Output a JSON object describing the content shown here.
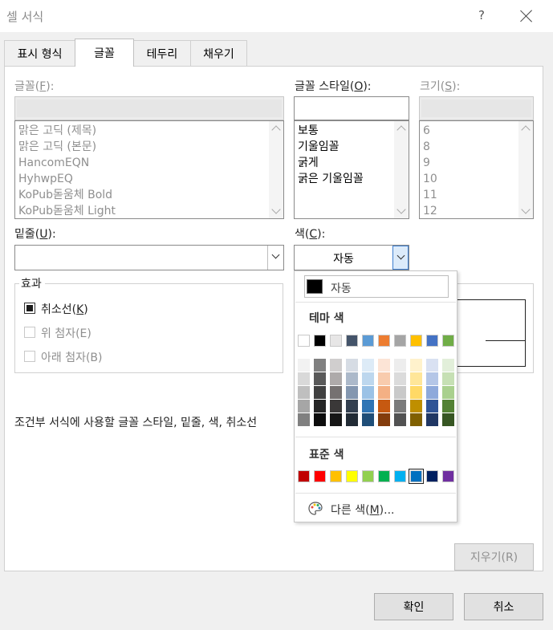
{
  "window": {
    "title": "셀 서식",
    "help": "?"
  },
  "tabs": [
    {
      "label": "표시 형식",
      "active": false
    },
    {
      "label": "글꼴",
      "active": true
    },
    {
      "label": "테두리",
      "active": false
    },
    {
      "label": "채우기",
      "active": false
    }
  ],
  "font": {
    "label_prefix": "글꼴(",
    "label_key": "F",
    "label_suffix": "):",
    "value": "",
    "items": [
      "맑은 고딕 (제목)",
      "맑은 고딕 (본문)",
      "HancomEQN",
      "HyhwpEQ",
      "KoPub돋움체 Bold",
      "KoPub돋움체 Light"
    ]
  },
  "style": {
    "label_prefix": "글꼴 스타일(",
    "label_key": "O",
    "label_suffix": "):",
    "value": "",
    "items": [
      "보통",
      "기울임꼴",
      "굵게",
      "굵은 기울임꼴"
    ]
  },
  "size": {
    "label_prefix": "크기(",
    "label_key": "S",
    "label_suffix": "):",
    "value": "",
    "items": [
      "6",
      "8",
      "9",
      "10",
      "11",
      "12"
    ]
  },
  "underline": {
    "label_prefix": "밑줄(",
    "label_key": "U",
    "label_suffix": "):",
    "value": ""
  },
  "color": {
    "label_prefix": "색(",
    "label_key": "C",
    "label_suffix": "):",
    "value": "자동"
  },
  "effects": {
    "title": "효과",
    "strike": {
      "label_prefix": "취소선(",
      "label_key": "K",
      "label_suffix": ")",
      "checked": true
    },
    "superscript": {
      "label": "위 첨자(E)",
      "checked": false
    },
    "subscript": {
      "label": "아래 첨자(B)",
      "checked": false
    }
  },
  "description": "조건부 서식에 사용할 글꼴 스타일, 밑줄, 색, 취소선",
  "buttons": {
    "clear": "지우기(R)",
    "ok": "확인",
    "cancel": "취소"
  },
  "color_picker": {
    "auto_label": "자동",
    "theme_header": "테마 색",
    "standard_header": "표준 색",
    "more_prefix": "다른 색(",
    "more_key": "M",
    "more_suffix": ")...",
    "theme_top": [
      "#FFFFFF",
      "#000000",
      "#E7E6E6",
      "#44546A",
      "#5B9BD5",
      "#ED7D31",
      "#A5A5A5",
      "#FFC000",
      "#4472C4",
      "#70AD47"
    ],
    "theme_shades": [
      [
        "#F2F2F2",
        "#808080",
        "#D0CECE",
        "#D6DCE4",
        "#DDEBF7",
        "#FCE4D6",
        "#EDEDED",
        "#FFF2CC",
        "#D9E1F2",
        "#E2EFDA"
      ],
      [
        "#D9D9D9",
        "#595959",
        "#AEAAAA",
        "#ACB9CA",
        "#BDD7EE",
        "#F8CBAD",
        "#DBDBDB",
        "#FFE699",
        "#B4C6E7",
        "#C6E0B4"
      ],
      [
        "#BFBFBF",
        "#404040",
        "#757171",
        "#8497B0",
        "#9BC2E6",
        "#F4B084",
        "#C9C9C9",
        "#FFD966",
        "#8EA9DB",
        "#A9D08E"
      ],
      [
        "#A6A6A6",
        "#262626",
        "#3A3838",
        "#333F4F",
        "#2F75B5",
        "#C65911",
        "#7B7B7B",
        "#BF8F00",
        "#305496",
        "#548235"
      ],
      [
        "#808080",
        "#0D0D0D",
        "#161616",
        "#222B35",
        "#1F4E78",
        "#833C0C",
        "#525252",
        "#806000",
        "#203764",
        "#375623"
      ]
    ],
    "standard": [
      "#C00000",
      "#FF0000",
      "#FFC000",
      "#FFFF00",
      "#92D050",
      "#00B050",
      "#00B0F0",
      "#0070C0",
      "#002060",
      "#7030A0"
    ],
    "selected_standard_index": 7
  }
}
